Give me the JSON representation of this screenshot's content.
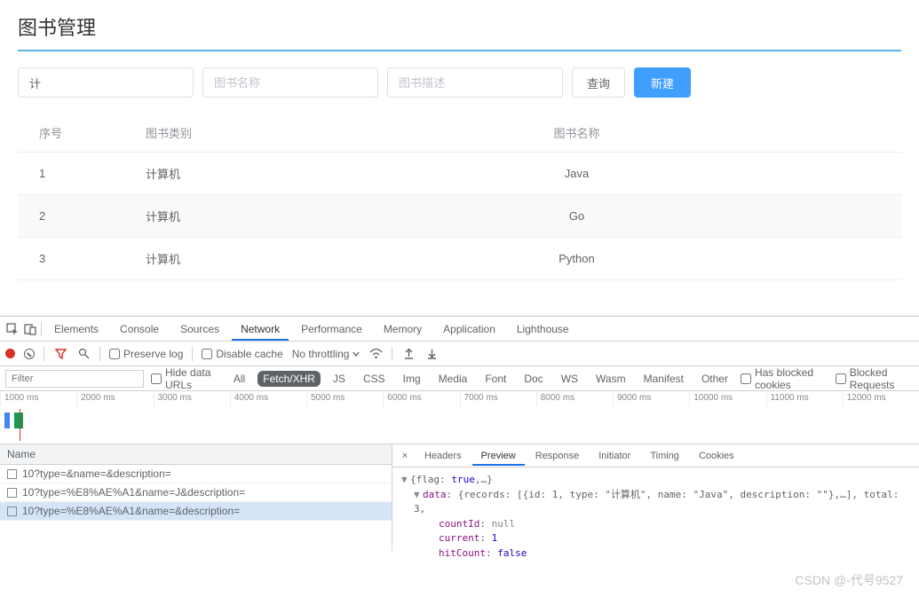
{
  "page_title": "图书管理",
  "search": {
    "category_value": "计",
    "name_placeholder": "图书名称",
    "desc_placeholder": "图书描述",
    "query_btn": "查询",
    "create_btn": "新建"
  },
  "table": {
    "headers": {
      "seq": "序号",
      "category": "图书类别",
      "name": "图书名称"
    },
    "rows": [
      {
        "seq": "1",
        "category": "计算机",
        "name": "Java"
      },
      {
        "seq": "2",
        "category": "计算机",
        "name": "Go"
      },
      {
        "seq": "3",
        "category": "计算机",
        "name": "Python"
      }
    ]
  },
  "devtools": {
    "tabs": [
      "Elements",
      "Console",
      "Sources",
      "Network",
      "Performance",
      "Memory",
      "Application",
      "Lighthouse"
    ],
    "active_tab": "Network",
    "toolbar": {
      "preserve_log": "Preserve log",
      "disable_cache": "Disable cache",
      "throttling": "No throttling"
    },
    "filter_placeholder": "Filter",
    "hide_data_urls": "Hide data URLs",
    "type_filters": [
      "All",
      "Fetch/XHR",
      "JS",
      "CSS",
      "Img",
      "Media",
      "Font",
      "Doc",
      "WS",
      "Wasm",
      "Manifest",
      "Other"
    ],
    "active_type_filter": "Fetch/XHR",
    "has_blocked_cookies": "Has blocked cookies",
    "blocked_requests": "Blocked Requests",
    "timeline_ticks": [
      "1000 ms",
      "2000 ms",
      "3000 ms",
      "4000 ms",
      "5000 ms",
      "6000 ms",
      "7000 ms",
      "8000 ms",
      "9000 ms",
      "10000 ms",
      "11000 ms",
      "12000 ms"
    ],
    "req_header": "Name",
    "requests": [
      "10?type=&name=&description=",
      "10?type=%E8%AE%A1&name=J&description=",
      "10?type=%E8%AE%A1&name=&description="
    ],
    "selected_request_index": 2,
    "preview_tabs": [
      "Headers",
      "Preview",
      "Response",
      "Initiator",
      "Timing",
      "Cookies"
    ],
    "active_preview_tab": "Preview",
    "response": {
      "line1_prefix": "{flag: ",
      "line1_flag": "true",
      "line1_suffix": ",…}",
      "data_prefix": "data",
      "data_body": ": {records: [{id: 1, type: \"计算机\", name: \"Java\", description: \"\"},…], total: 3,",
      "countId_k": "countId",
      "countId_v": "null",
      "current_k": "current",
      "current_v": "1",
      "hitCount_k": "hitCount",
      "hitCount_v": "false"
    }
  },
  "watermark": "CSDN @-代号9527"
}
